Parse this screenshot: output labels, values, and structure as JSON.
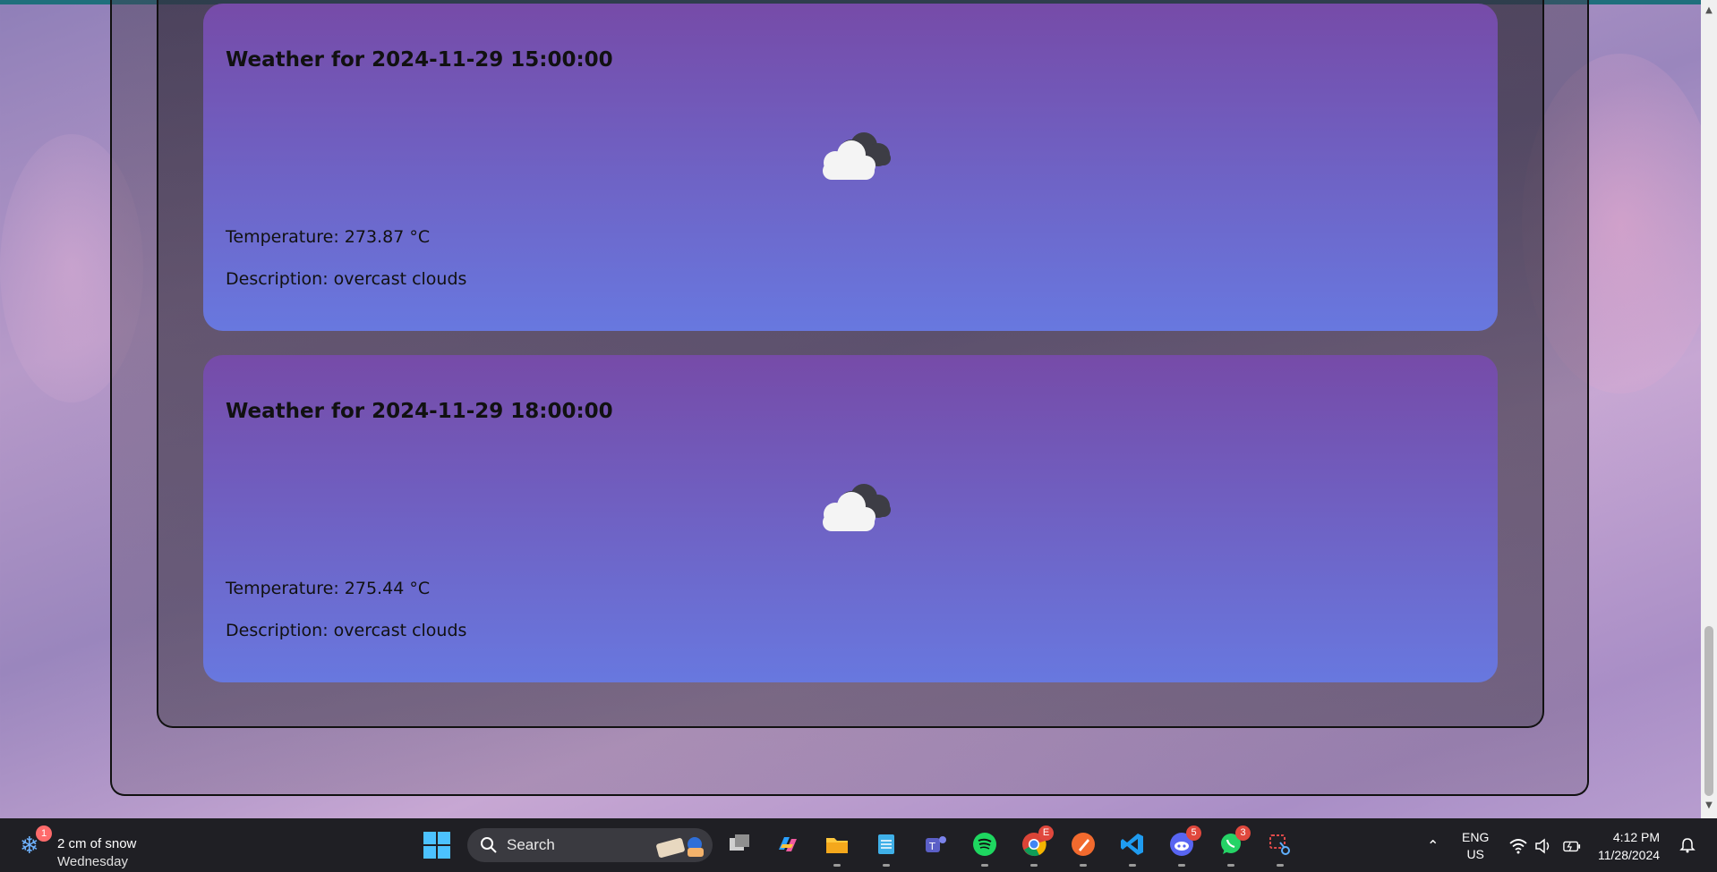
{
  "forecast_cards": [
    {
      "title": "Weather for 2024-11-29 15:00:00",
      "temperature": "Temperature: 273.87 °C",
      "description": "Description: overcast clouds",
      "icon": "overcast-cloud-icon"
    },
    {
      "title": "Weather for 2024-11-29 18:00:00",
      "temperature": "Temperature: 275.44 °C",
      "description": "Description: overcast clouds",
      "icon": "overcast-cloud-icon"
    }
  ],
  "taskbar": {
    "weather": {
      "notification_count": "1",
      "condition": "2 cm of snow",
      "day": "Wednesday",
      "icon": "snowflake-icon"
    },
    "search": {
      "label": "Search"
    },
    "apps": [
      {
        "name": "Task View",
        "icon": "task-view-icon"
      },
      {
        "name": "Copilot",
        "icon": "copilot-icon"
      },
      {
        "name": "File Explorer",
        "icon": "folder-icon"
      },
      {
        "name": "Notepad",
        "icon": "notepad-icon"
      },
      {
        "name": "Teams",
        "icon": "teams-icon"
      },
      {
        "name": "Spotify",
        "icon": "spotify-icon"
      },
      {
        "name": "Chrome",
        "icon": "chrome-icon",
        "badge": "E"
      },
      {
        "name": "Pen app",
        "icon": "pen-icon"
      },
      {
        "name": "VS Code",
        "icon": "vscode-icon"
      },
      {
        "name": "Discord",
        "icon": "discord-icon",
        "badge": "5"
      },
      {
        "name": "WhatsApp",
        "icon": "whatsapp-icon",
        "badge": "3"
      },
      {
        "name": "Snipping Tool",
        "icon": "snipping-tool-icon"
      }
    ],
    "language": {
      "line1": "ENG",
      "line2": "US"
    },
    "clock": {
      "time": "4:12 PM",
      "date": "11/28/2024"
    }
  },
  "colors": {
    "card_gradient_top": "#764ba8",
    "card_gradient_bottom": "#6878df",
    "taskbar_bg": "#1f1f24"
  }
}
